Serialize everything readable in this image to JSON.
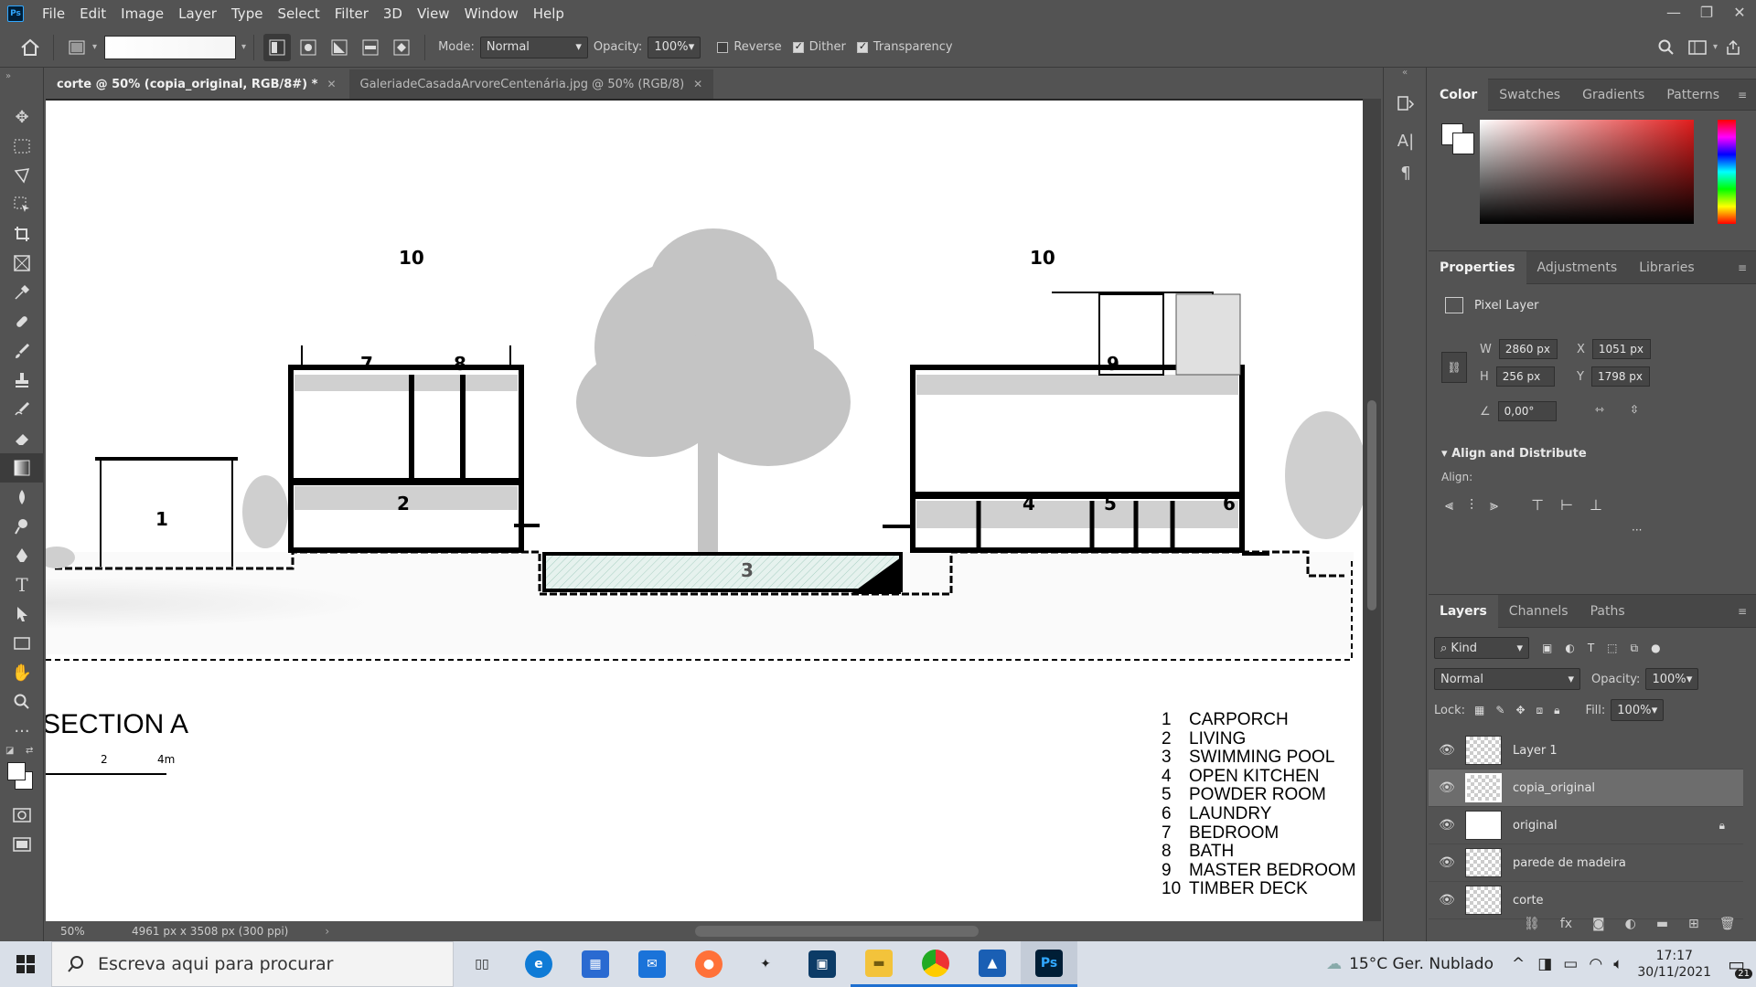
{
  "app": {
    "logo": "Ps",
    "menu": [
      "File",
      "Edit",
      "Image",
      "Layer",
      "Type",
      "Select",
      "Filter",
      "3D",
      "View",
      "Window",
      "Help"
    ],
    "window_controls": [
      "—",
      "❐",
      "✕"
    ]
  },
  "options_bar": {
    "mode_label": "Mode:",
    "mode_value": "Normal",
    "opacity_label": "Opacity:",
    "opacity_value": "100%",
    "reverse_label": "Reverse",
    "dither_label": "Dither",
    "transparency_label": "Transparency"
  },
  "tabs": [
    {
      "label": "corte @ 50% (copia_original, RGB/8#) *",
      "active": true
    },
    {
      "label": "GaleriadeCasadaArvoreCentenária.jpg @ 50% (RGB/8)",
      "active": false
    }
  ],
  "drawing": {
    "room_numbers": [
      "1",
      "2",
      "3",
      "4",
      "5",
      "6",
      "7",
      "8",
      "9",
      "10",
      "10"
    ],
    "section_title": "SECTION A",
    "scale_labels": [
      "2",
      "4m"
    ],
    "legend": [
      {
        "num": "1",
        "name": "CARPORCH"
      },
      {
        "num": "2",
        "name": "LIVING"
      },
      {
        "num": "3",
        "name": "SWIMMING POOL"
      },
      {
        "num": "4",
        "name": "OPEN KITCHEN"
      },
      {
        "num": "5",
        "name": "POWDER ROOM"
      },
      {
        "num": "6",
        "name": "LAUNDRY"
      },
      {
        "num": "7",
        "name": "BEDROOM"
      },
      {
        "num": "8",
        "name": "BATH"
      },
      {
        "num": "9",
        "name": "MASTER BEDROOM"
      },
      {
        "num": "10",
        "name": "TIMBER DECK"
      }
    ]
  },
  "status": {
    "zoom": "50%",
    "doc_info": "4961 px x 3508 px (300 ppi)"
  },
  "color_panel": {
    "tabs": [
      "Color",
      "Swatches",
      "Gradients",
      "Patterns"
    ],
    "hue_base": "#e11d1d"
  },
  "properties_panel": {
    "tabs": [
      "Properties",
      "Adjustments",
      "Libraries"
    ],
    "layer_type": "Pixel Layer",
    "w_label": "W",
    "w_value": "2860 px",
    "h_label": "H",
    "h_value": "256 px",
    "x_label": "X",
    "x_value": "1051 px",
    "y_label": "Y",
    "y_value": "1798 px",
    "angle_value": "0,00°",
    "align_section": "Align and Distribute",
    "align_label": "Align:"
  },
  "layers_panel": {
    "tabs": [
      "Layers",
      "Channels",
      "Paths"
    ],
    "filter_label": "Kind",
    "blend_mode": "Normal",
    "opacity_label": "Opacity:",
    "opacity_value": "100%",
    "lock_label": "Lock:",
    "fill_label": "Fill:",
    "fill_value": "100%",
    "layers": [
      {
        "name": "Layer 1",
        "selected": false,
        "locked": false
      },
      {
        "name": "copia_original",
        "selected": true,
        "locked": false
      },
      {
        "name": "original",
        "selected": false,
        "locked": true
      },
      {
        "name": "parede de madeira",
        "selected": false,
        "locked": false
      },
      {
        "name": "corte",
        "selected": false,
        "locked": false
      }
    ]
  },
  "taskbar": {
    "search_placeholder": "Escreva aqui para procurar",
    "weather": "15°C  Ger. Nublado",
    "time": "17:17",
    "date": "30/11/2021",
    "notification_count": "21"
  }
}
